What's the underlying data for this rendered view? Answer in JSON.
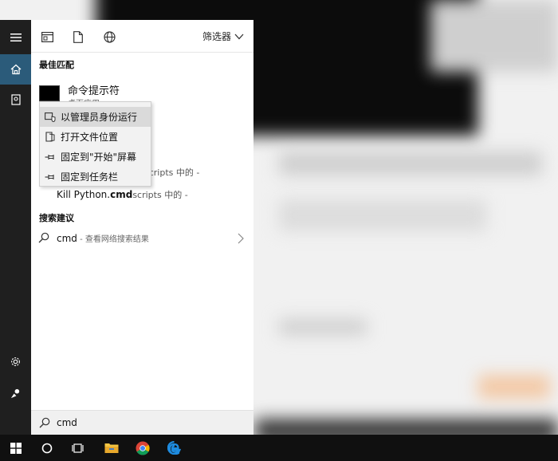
{
  "filter_label": "筛选器",
  "best_match": {
    "section": "最佳匹配",
    "app_title": "命令提示符",
    "app_subtitle": "桌面应用"
  },
  "documents": {
    "row1_suffix": "scripts 中的 -",
    "row2_prefix": "Kill Python.",
    "row2_bold": "cmd",
    "row2_suffix": "scripts 中的 -"
  },
  "suggestions": {
    "section": "搜索建议",
    "query": "cmd",
    "hint": " - 查看网络搜索结果"
  },
  "context_menu": [
    {
      "label": "以管理员身份运行",
      "icon": "run-as-admin-icon",
      "highlighted": true
    },
    {
      "label": "打开文件位置",
      "icon": "open-folder-icon",
      "highlighted": false
    },
    {
      "label": "固定到\"开始\"屏幕",
      "icon": "pin-icon",
      "highlighted": false
    },
    {
      "label": "固定到任务栏",
      "icon": "pin-icon",
      "highlighted": false
    }
  ],
  "search": {
    "value": "cmd"
  },
  "colors": {
    "rail": "#1f1f1f",
    "rail_active": "#2b5b7a",
    "taskbar": "#101010",
    "panel": "#ffffff",
    "highlight": "#dadada"
  }
}
